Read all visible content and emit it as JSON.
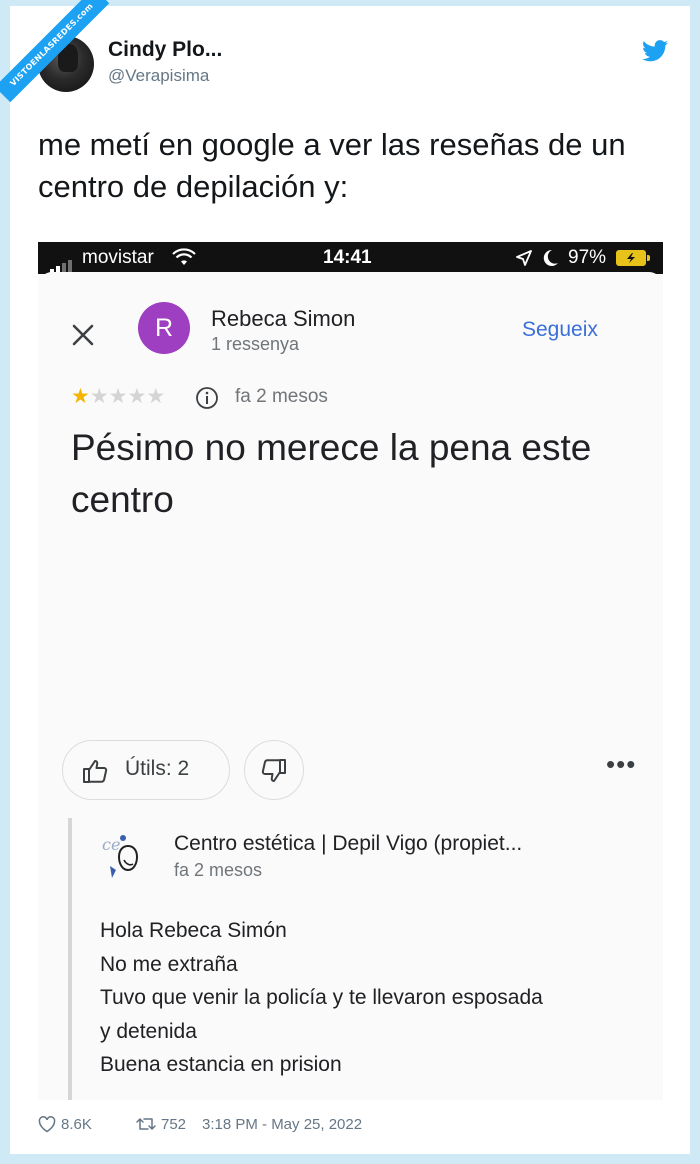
{
  "watermark": "VISTOENLASREDES.com",
  "tweet": {
    "author_name": "Cindy Plo...",
    "author_handle": "@Verapisima",
    "text": "me metí en google a ver las reseñas de un centro de depilación y:",
    "likes": "8.6K",
    "retweets": "752",
    "timestamp": "3:18 PM - May 25, 2022"
  },
  "status_bar": {
    "carrier": "movistar",
    "time": "14:41",
    "battery": "97%"
  },
  "review": {
    "reviewer_initial": "R",
    "reviewer_name": "Rebeca Simon",
    "reviewer_count": "1 ressenya",
    "follow_label": "Segueix",
    "rating": 1,
    "stars_total": 5,
    "time": "fa 2 mesos",
    "text": "Pésimo no merece la pena este centro",
    "helpful_label": "Útils: 2",
    "more_label": "•••"
  },
  "owner_reply": {
    "name": "Centro estética | Depil Vigo (propiet...",
    "time": "fa 2 mesos",
    "lines": [
      "Hola Rebeca Simón",
      "No me extraña",
      "Tuvo que venir la policía y te llevaron esposada",
      "y detenida",
      "Buena estancia en prision"
    ]
  },
  "colors": {
    "frame": "#cfe9f7",
    "twitter_blue": "#1da1f2",
    "avatar_purple": "#9e3ec0",
    "link_blue": "#3a6fd8",
    "star_gold": "#f4b400"
  },
  "icons": {
    "twitter": "twitter-bird-icon",
    "close": "close-icon",
    "info": "info-icon",
    "thumb_up": "thumb-up-icon",
    "thumb_down": "thumb-down-icon",
    "heart": "heart-icon",
    "retweet": "retweet-icon"
  }
}
